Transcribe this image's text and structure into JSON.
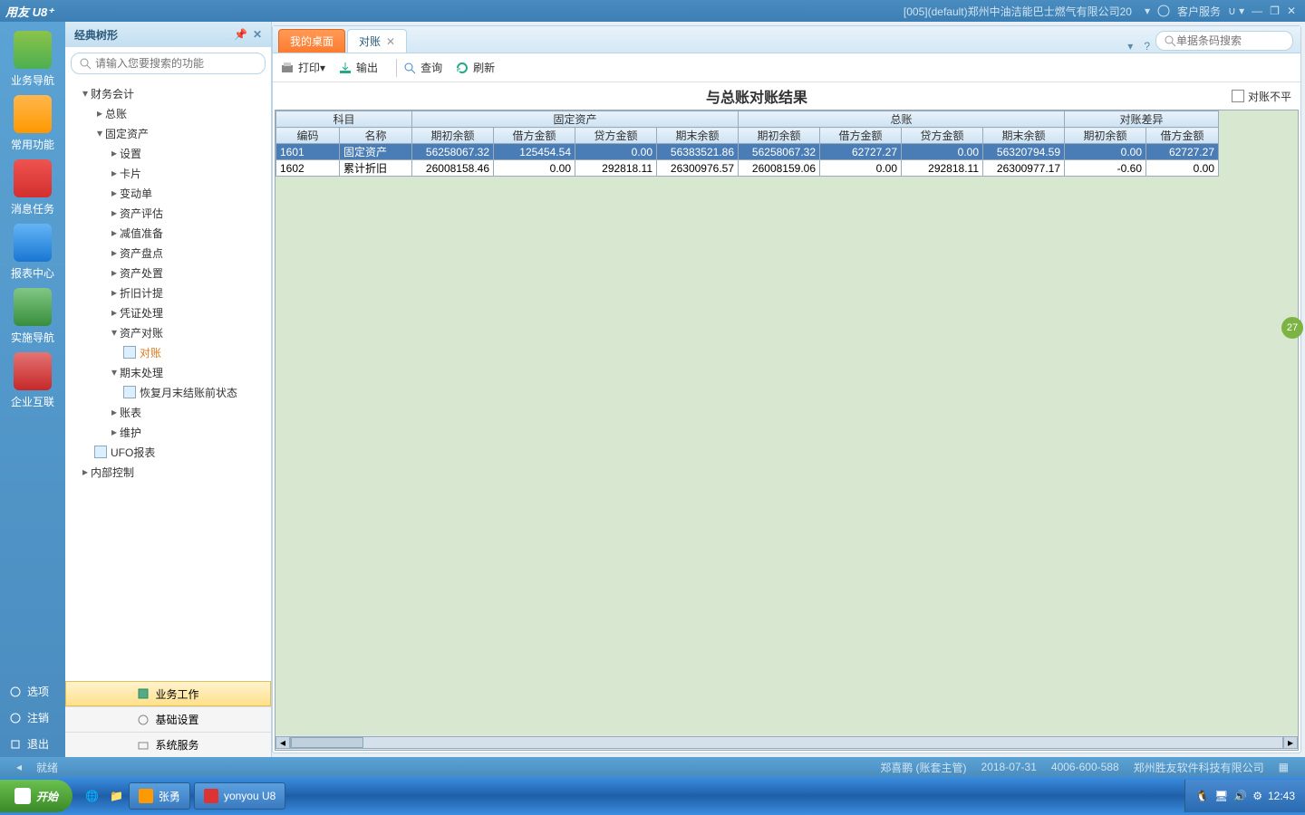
{
  "title": {
    "logo": "用友 U8⁺",
    "company": "[005](default)郑州中油洁能巴士燃气有限公司20",
    "service": "客户服务"
  },
  "leftbar": {
    "items": [
      "业务导航",
      "常用功能",
      "消息任务",
      "报表中心",
      "实施导航",
      "企业互联"
    ],
    "bottom": [
      "选项",
      "注销",
      "退出"
    ]
  },
  "sidebar": {
    "title": "经典树形",
    "search_placeholder": "请输入您要搜索的功能",
    "tree": {
      "n0": "财务会计",
      "n1": "总账",
      "n2": "固定资产",
      "n3": "设置",
      "n4": "卡片",
      "n5": "变动单",
      "n6": "资产评估",
      "n7": "减值准备",
      "n8": "资产盘点",
      "n9": "资产处置",
      "n10": "折旧计提",
      "n11": "凭证处理",
      "n12": "资产对账",
      "n13": "对账",
      "n14": "期末处理",
      "n15": "恢复月末结账前状态",
      "n16": "账表",
      "n17": "维护",
      "n18": "UFO报表",
      "n19": "内部控制"
    },
    "foot": [
      "业务工作",
      "基础设置",
      "系统服务"
    ]
  },
  "tabs": {
    "t1": "我的桌面",
    "t2": "对账",
    "search_placeholder": "单据条码搜索"
  },
  "toolbar": {
    "print": "打印",
    "export": "输出",
    "query": "查询",
    "refresh": "刷新"
  },
  "page": {
    "title": "与总账对账结果",
    "checkbox": "对账不平"
  },
  "table": {
    "g1": "科目",
    "g2": "固定资产",
    "g3": "总账",
    "g4": "对账差异",
    "h1": "编码",
    "h2": "名称",
    "h3": "期初余额",
    "h4": "借方金额",
    "h5": "贷方金额",
    "h6": "期末余额",
    "h7": "期初余额",
    "h8": "借方金额",
    "h9": "贷方金额",
    "h10": "期末余额",
    "h11": "期初余额",
    "h12": "借方金额",
    "r1": {
      "c1": "1601",
      "c2": "固定资产",
      "c3": "56258067.32",
      "c4": "125454.54",
      "c5": "0.00",
      "c6": "56383521.86",
      "c7": "56258067.32",
      "c8": "62727.27",
      "c9": "0.00",
      "c10": "56320794.59",
      "c11": "0.00",
      "c12": "62727.27"
    },
    "r2": {
      "c1": "1602",
      "c2": "累计折旧",
      "c3": "26008158.46",
      "c4": "0.00",
      "c5": "292818.11",
      "c6": "26300976.57",
      "c7": "26008159.06",
      "c8": "0.00",
      "c9": "292818.11",
      "c10": "26300977.17",
      "c11": "-0.60",
      "c12": "0.00"
    }
  },
  "status": {
    "ready": "就绪",
    "user": "郑喜鹏 (账套主管)",
    "date": "2018-07-31",
    "phone": "4006-600-588",
    "vendor": "郑州胜友软件科技有限公司"
  },
  "taskbar": {
    "start": "开始",
    "t1": "张勇",
    "t2": "yonyou U8",
    "clock": "12:43"
  },
  "badge": "27"
}
